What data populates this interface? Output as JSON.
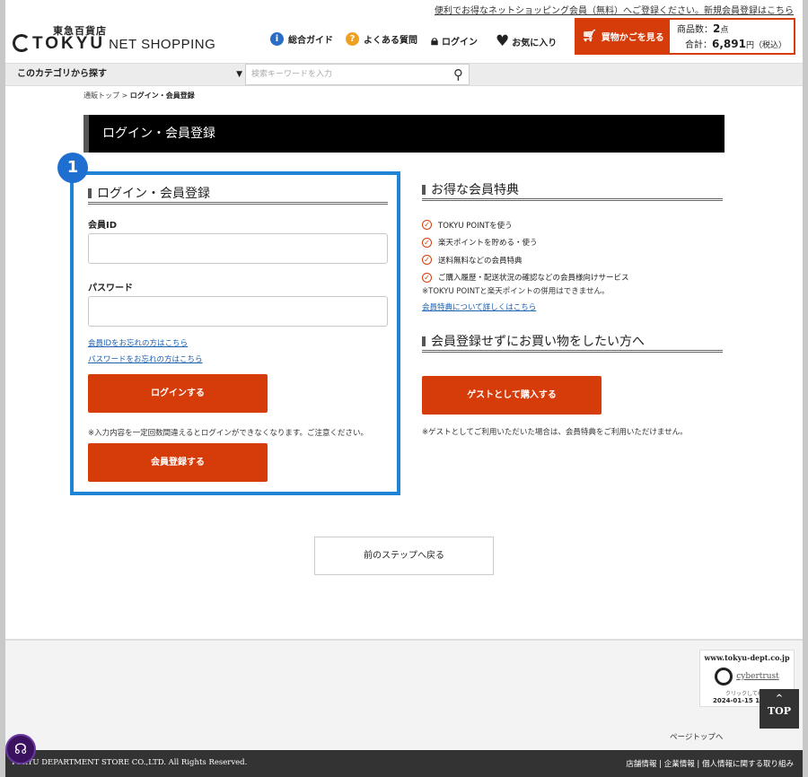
{
  "header": {
    "top_link": "便利でお得なネットショッピング会員（無料）へご登録ください。新規会員登録はこちら",
    "logo_small": "東急百貨店",
    "logo_main": "TOKYU",
    "logo_sub": "NET SHOPPING",
    "nav": {
      "guide": "総合ガイド",
      "faq": "よくある質問",
      "login": "ログイン",
      "favorites": "お気に入り"
    },
    "cart": {
      "button": "買物かごを見る",
      "count_label": "商品数：",
      "count_value": "2",
      "count_unit": "点",
      "total_label": "合計：",
      "total_value": "6,891",
      "total_unit": "円",
      "tax_note": "（税込）"
    }
  },
  "search": {
    "category": "このカテゴリから探す",
    "placeholder": "検索キーワードを入力"
  },
  "breadcrumb": {
    "home": "通販トップ",
    "separator": " > ",
    "current": "ログイン・会員登録"
  },
  "page_title": "ログイン・会員登録",
  "badge": "1",
  "login": {
    "heading": "ログイン・会員登録",
    "member_id_label": "会員ID",
    "password_label": "パスワード",
    "forgot_id": "会員IDをお忘れの方はこちら",
    "forgot_password": "パスワードをお忘れの方はこちら",
    "login_button": "ログインする",
    "warning": "※入力内容を一定回数間違えるとログインができなくなります。ご注意ください。",
    "register_button": "会員登録する"
  },
  "benefits": {
    "heading": "お得な会員特典",
    "items": [
      "TOKYU POINTを使う",
      "楽天ポイントを貯める・使う",
      "送料無料などの会員特典",
      "ご購入履歴・配送状況の確認などの会員様向けサービス"
    ],
    "note": "※TOKYU POINTと楽天ポイントの併用はできません。",
    "link": "会員特典について詳しくはこちら"
  },
  "guest": {
    "heading": "会員登録せずにお買い物をしたい方へ",
    "button": "ゲストとして購入する",
    "note": "※ゲストとしてご利用いただいた場合は、会員特典をご利用いただけません。"
  },
  "back_button": "前のステップへ戻る",
  "footer": {
    "seal_url": "www.tokyu-dept.co.jp",
    "seal_brand": "cybertrust",
    "seal_sub": "クリックして検証",
    "seal_date": "2024-01-15 11",
    "top_button": "TOP",
    "page_top": "ページトップへ",
    "copyright": "TOKYU DEPARTMENT STORE CO.,LTD. All Rights Reserved.",
    "links": [
      "店舗情報",
      "企業情報",
      "個人情報に関する取り組み"
    ],
    "link_separator": " | "
  },
  "colors": {
    "accent": "#d63c0a",
    "highlight_border": "#1f84d6",
    "badge": "#1f6fd1",
    "link": "#1a5fb0"
  }
}
